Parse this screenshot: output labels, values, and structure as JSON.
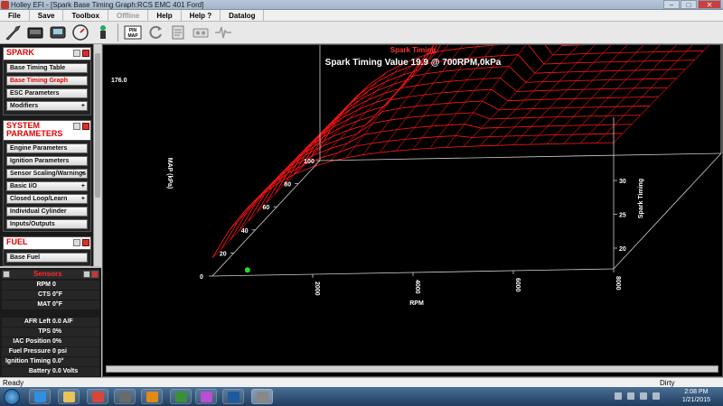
{
  "window": {
    "title": "Holley EFI - [Spark Base Timing Graph:RCS EMC 401 Ford]"
  },
  "menu": [
    "File",
    "Save",
    "Toolbox",
    "Offline",
    "Help",
    "Help ?",
    "Datalog"
  ],
  "toolbar": {
    "icons": [
      "wrench-icon",
      "ecu-icon",
      "handheld-icon",
      "gauge-icon",
      "usb-icon",
      "pin-map-icon",
      "refresh-icon",
      "notes-icon",
      "tape-icon",
      "waveform-icon"
    ]
  },
  "spark_panel": {
    "title": "SPARK",
    "items": [
      {
        "label": "Base Timing Table",
        "plus": ""
      },
      {
        "label": "Base Timing Graph",
        "plus": ""
      },
      {
        "label": "ESC Parameters",
        "plus": ""
      },
      {
        "label": "Modifiers",
        "plus": "+"
      }
    ]
  },
  "system_panel": {
    "title": "SYSTEM\nPARAMETERS",
    "items": [
      {
        "label": "Engine Parameters",
        "plus": ""
      },
      {
        "label": "Ignition Parameters",
        "plus": ""
      },
      {
        "label": "Sensor Scaling/Warnings",
        "plus": "+"
      },
      {
        "label": "Basic I/O",
        "plus": "+"
      },
      {
        "label": "Closed Loop/Learn",
        "plus": "+"
      },
      {
        "label": "Individual Cylinder",
        "plus": ""
      },
      {
        "label": "Inputs/Outputs",
        "plus": ""
      }
    ]
  },
  "fuel_panel": {
    "title": "FUEL",
    "items": [
      {
        "label": "Base Fuel",
        "plus": ""
      }
    ]
  },
  "sensors": {
    "title": "Sensors",
    "rows": [
      {
        "label": "RPM",
        "value": "0"
      },
      {
        "label": "CTS",
        "value": "0°F"
      },
      {
        "label": "MAT",
        "value": "0°F"
      },
      {
        "label": "AFR Left",
        "value": "0.0 A/F"
      },
      {
        "label": "TPS",
        "value": "0%"
      },
      {
        "label": "IAC Position",
        "value": "0%"
      },
      {
        "label": "Fuel Pressure",
        "value": "0 psi"
      },
      {
        "label": "Ignition Timing",
        "value": "0.0°"
      },
      {
        "label": "Battery",
        "value": "0.0 Volts"
      }
    ]
  },
  "chart": {
    "header": "Spark Timing",
    "subtitle": "Spark Timing Value 19.9 @ 700RPM,0kPa",
    "corner_value": "176.0",
    "map_axis_label": "MAP (kPa)",
    "rpm_axis_label": "RPM",
    "timing_axis_label": "Spark Timing",
    "map_ticks": [
      "0",
      "20",
      "40",
      "60",
      "80",
      "100"
    ],
    "rpm_ticks": [
      "2000",
      "4000",
      "6000",
      "8000"
    ],
    "timing_ticks": [
      "20",
      "25",
      "30"
    ]
  },
  "chart_data": {
    "type": "surface",
    "title": "Spark Timing",
    "subtitle": "Spark Timing Value 19.9 @ 700RPM,0kPa",
    "xlabel": "RPM",
    "ylabel": "MAP (kPa)",
    "zlabel": "Spark Timing",
    "xlim": [
      0,
      8000
    ],
    "ylim": [
      0,
      100
    ],
    "zlim": [
      18,
      34
    ],
    "selected_point": {
      "rpm": 700,
      "map": 0,
      "timing": 19.9
    }
  },
  "status": {
    "left": "Ready",
    "dirty": "Dirty"
  },
  "taskbar": {
    "time": "2:08 PM",
    "date": "1/21/2015",
    "apps": [
      {
        "name": "ie-icon",
        "color": "#2f8fe0"
      },
      {
        "name": "folder-icon",
        "color": "#e8c25a"
      },
      {
        "name": "chrome-icon",
        "color": "#d8453a"
      },
      {
        "name": "media-icon",
        "color": "#6a6a6a"
      },
      {
        "name": "outlook-icon",
        "color": "#e08a1a"
      },
      {
        "name": "dreamweaver-icon",
        "color": "#3a8f3a"
      },
      {
        "name": "picasa-icon",
        "color": "#b84fd4"
      },
      {
        "name": "photoshop-icon",
        "color": "#1d5aa0"
      },
      {
        "name": "holley-icon",
        "color": "#888888"
      }
    ]
  }
}
